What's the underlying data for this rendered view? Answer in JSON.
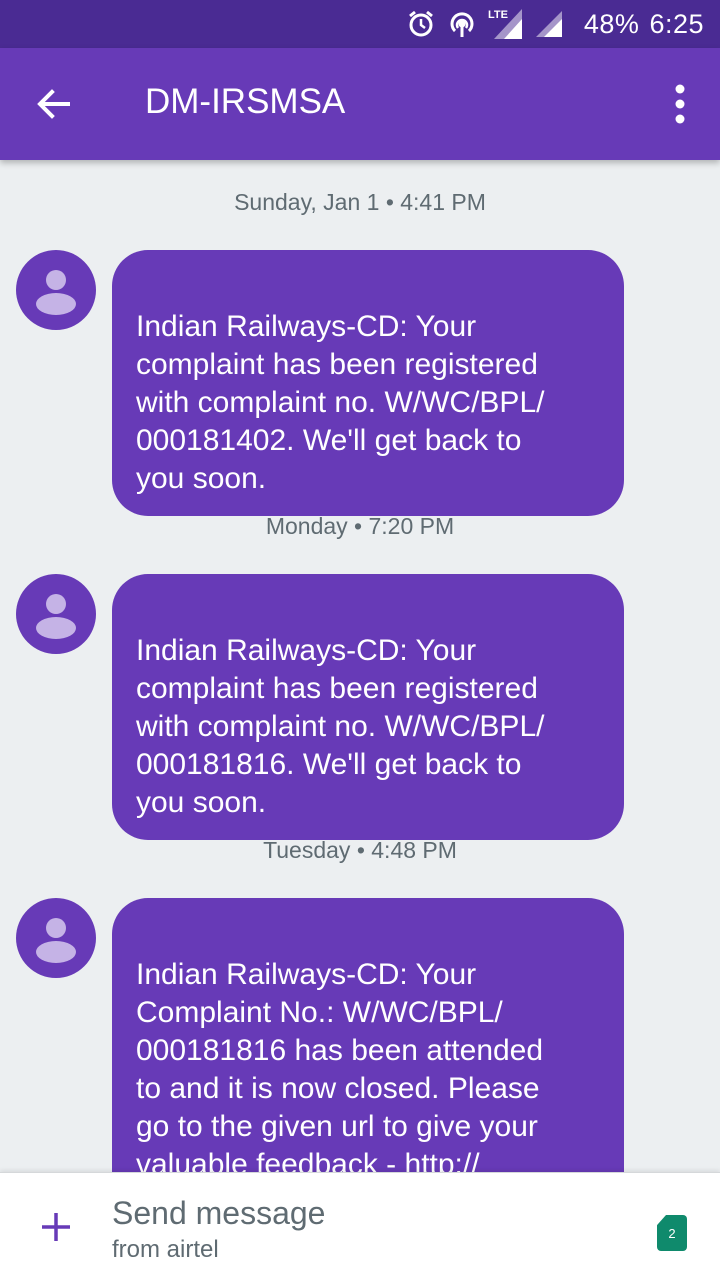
{
  "status_bar": {
    "battery": "48%",
    "time": "6:25",
    "network_label": "LTE",
    "icons": [
      "alarm-icon",
      "hotspot-icon",
      "lte-signal-icon",
      "signal-icon"
    ]
  },
  "toolbar": {
    "title": "DM-IRSMSA",
    "back_icon": "arrow-left-icon",
    "menu_icon": "more-vert-icon"
  },
  "colors": {
    "status_bar": "#4A2B93",
    "toolbar": "#673AB7",
    "bubble": "#673AB7",
    "background": "#ECEFF1",
    "sim_badge": "#0F8A6C"
  },
  "messages": [
    {
      "timestamp": "Sunday, Jan 1 • 4:41 PM",
      "text": "Indian Railways-CD: Your\ncomplaint has been registered\nwith complaint no. W/WC/BPL/\n000181402. We'll get back to\nyou soon."
    },
    {
      "timestamp": "Monday • 7:20 PM",
      "text": "Indian Railways-CD: Your\ncomplaint has been registered\nwith complaint no. W/WC/BPL/\n000181816. We'll get back to\nyou soon."
    },
    {
      "timestamp": "Tuesday • 4:48 PM",
      "text": "Indian Railways-CD: Your\nComplaint No.: W/WC/BPL/\n000181816 has been attended\nto and it is now closed. Please\ngo to the given url to give your\nvaluable feedback - ",
      "link": "http://\ncoms.indianrailways.gov.in/"
    }
  ],
  "composer": {
    "placeholder": "Send message",
    "subtext": "from airtel",
    "sim_number": "2",
    "add_icon": "plus-icon"
  }
}
